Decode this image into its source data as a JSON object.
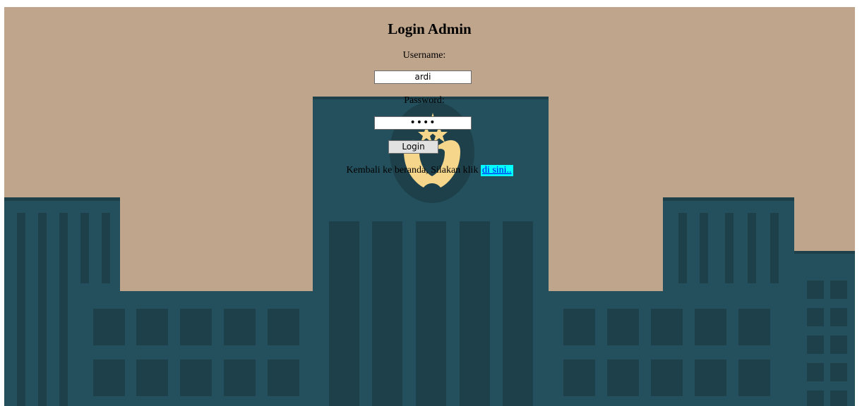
{
  "login": {
    "title": "Login Admin",
    "username_label": "Username:",
    "username_value": "ardi",
    "password_label": "Password:",
    "password_value": "••••",
    "button_label": "Login",
    "back_text": "Kembali ke beranda, Silakan klik ",
    "back_link": "di sini.."
  },
  "background": {
    "icon": "police-emblem-icon",
    "colors": {
      "sky": "#bfa58c",
      "building": "#244f5c",
      "building_dark": "#1d404a",
      "emblem": "#f5d68b"
    }
  }
}
